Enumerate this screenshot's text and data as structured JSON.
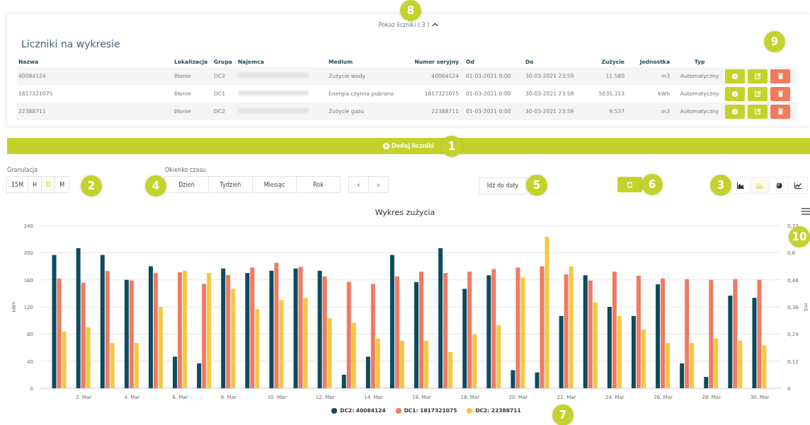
{
  "meters_panel": {
    "toggle": {
      "label": "Pokaż liczniki ( 3 )",
      "expanded": true,
      "marker": "8"
    },
    "title": "Liczniki na wykresie",
    "table": {
      "marker": "9",
      "columns": [
        "Nazwa",
        "Lokalizacja",
        "Grupa",
        "Najemca",
        "Medium",
        "Numer seryjny",
        "Od",
        "Do",
        "Zużycie",
        "Jednostka",
        "Typ"
      ],
      "rows": [
        {
          "name": "40084124",
          "location": "Błonie",
          "group": "DC2",
          "medium": "Zużycie wody",
          "serial": "40084124",
          "from": "01-03-2021 0:00",
          "to": "30-03-2021 23:59",
          "usage": "11.580",
          "unit": "m3",
          "type": "Automatyczny"
        },
        {
          "name": "1817321075",
          "location": "Błonie",
          "group": "DC1",
          "medium": "Energia czynna pobrana",
          "serial": "1817321075",
          "from": "01-03-2021 0:00",
          "to": "30-03-2021 23:59",
          "usage": "5035.313",
          "unit": "kWh",
          "type": "Automatyczny"
        },
        {
          "name": "22388711",
          "location": "Błonie",
          "group": "DC2",
          "medium": "Zużycie gazu",
          "serial": "22388711",
          "from": "01-03-2021 0:00",
          "to": "30-03-2021 23:59",
          "usage": "9.537",
          "unit": "m3",
          "type": "Automatyczny"
        }
      ]
    }
  },
  "add_button": {
    "label": "Dodaj liczniki",
    "marker": "1"
  },
  "granularity": {
    "label": "Granulacja",
    "marker": "2",
    "options": [
      {
        "label": "15M",
        "selected": false
      },
      {
        "label": "H",
        "selected": false
      },
      {
        "label": "D",
        "selected": true
      },
      {
        "label": "M",
        "selected": false
      }
    ]
  },
  "time_window": {
    "label": "Okienko czasu",
    "marker": "4",
    "options": [
      {
        "label": "Dzień"
      },
      {
        "label": "Tydzień"
      },
      {
        "label": "Miesiąc"
      },
      {
        "label": "Rok"
      }
    ],
    "prev": "‹",
    "next": "›"
  },
  "goto_date": {
    "label": "Idź do daty",
    "marker": "5"
  },
  "refresh": {
    "marker": "6"
  },
  "chart_types": {
    "marker": "3",
    "options": [
      {
        "kind": "area",
        "selected": false
      },
      {
        "kind": "bar",
        "selected": true
      },
      {
        "kind": "pie",
        "selected": false
      },
      {
        "kind": "line",
        "selected": false
      }
    ]
  },
  "chart": {
    "menu_marker": "10",
    "legend_marker": "7",
    "chart_data": {
      "type": "bar",
      "title": "Wykres zużycia",
      "ylabel": "kWh",
      "y2label": "m3",
      "categories": [
        null,
        "2. Mar",
        null,
        "4. Mar",
        null,
        "6. Mar",
        null,
        "8. Mar",
        null,
        "10. Mar",
        null,
        "12. Mar",
        null,
        "14. Mar",
        null,
        "16. Mar",
        null,
        "18. Mar",
        null,
        "20. Mar",
        null,
        "22. Mar",
        null,
        "24. Mar",
        null,
        "26. Mar",
        null,
        "28. Mar",
        null,
        "30. Mar"
      ],
      "grid": true,
      "ylim": [
        0,
        240
      ],
      "yticks": [
        0,
        40,
        80,
        120,
        160,
        200,
        240
      ],
      "y2lim": [
        0,
        0.72
      ],
      "y2ticks": [
        {
          "value": 0,
          "label": "0"
        },
        {
          "value": 0.12,
          "label": "0,12"
        },
        {
          "value": 0.24,
          "label": "0,24"
        },
        {
          "value": 0.36,
          "label": "0,36"
        },
        {
          "value": 0.48,
          "label": "0,48"
        },
        {
          "value": 0.6,
          "label": "0,6"
        },
        {
          "value": 0.72,
          "label": "0,72"
        }
      ],
      "series": [
        {
          "name": "DC2: 40084124",
          "color": "#0d4c5e",
          "axis": "y2",
          "values": [
            0.59,
            0.62,
            0.59,
            0.48,
            0.54,
            0.14,
            0.11,
            0.53,
            0.51,
            0.52,
            0.53,
            0.52,
            0.06,
            0.14,
            0.59,
            0.47,
            0.62,
            0.44,
            0.5,
            0.08,
            0.07,
            0.32,
            0.5,
            0.36,
            0.32,
            0.46,
            0.11,
            0.05,
            0.41,
            0.4
          ]
        },
        {
          "name": "DC1: 1817321075",
          "color": "#f07a62",
          "values": [
            162,
            156,
            173,
            159,
            170,
            171,
            154,
            167,
            178,
            185,
            179,
            165,
            157,
            154,
            165,
            172,
            170,
            172,
            176,
            178,
            180,
            168,
            159,
            172,
            166,
            162,
            161,
            160,
            161,
            160
          ]
        },
        {
          "name": "DC2: 22388711",
          "color": "#f5c842",
          "axis": "y2",
          "values": [
            0.25,
            0.27,
            0.2,
            0.2,
            0.36,
            0.52,
            0.51,
            0.44,
            0.35,
            0.39,
            0.4,
            0.31,
            0.29,
            0.22,
            0.21,
            0.21,
            0.16,
            0.24,
            0.28,
            0.49,
            0.67,
            0.54,
            0.38,
            0.32,
            0.26,
            0.2,
            0.2,
            0.22,
            0.21,
            0.19
          ]
        }
      ]
    }
  }
}
